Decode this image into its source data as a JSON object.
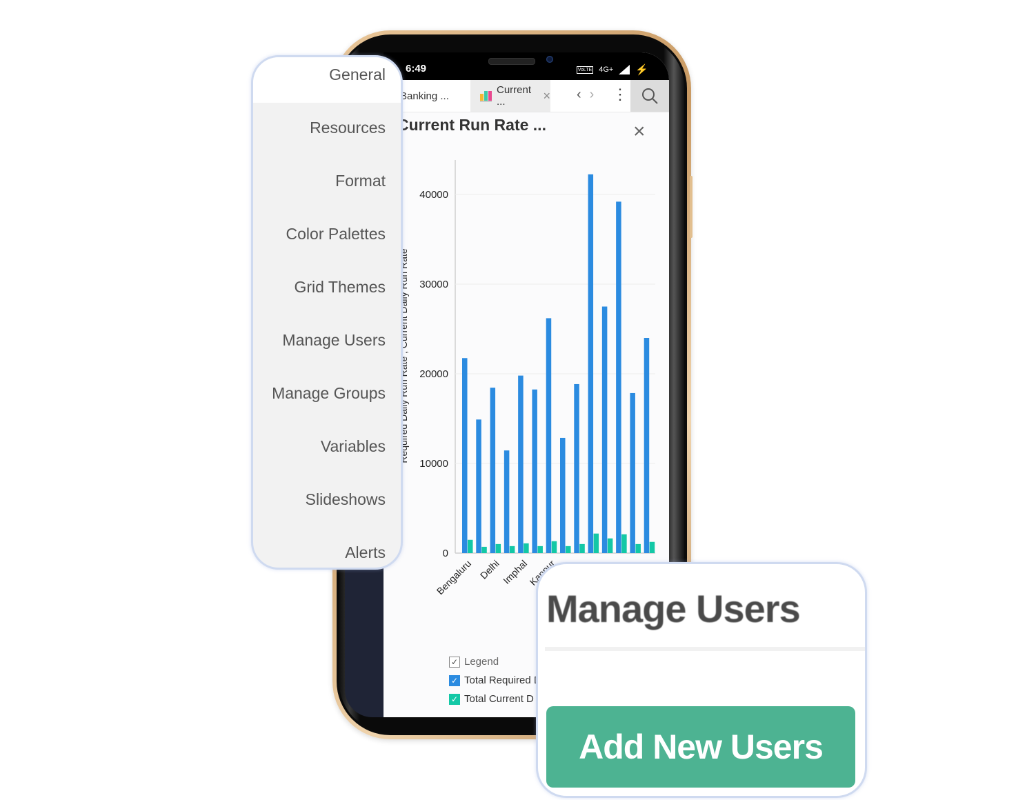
{
  "status_bar": {
    "time": "6:49",
    "network": "4G+",
    "volte": "Vo LTE"
  },
  "tabs": [
    {
      "label": "Banking ...",
      "active": false
    },
    {
      "label": "Current ...",
      "active": true,
      "icon": "bar-chart-icon"
    }
  ],
  "tab_icon_colors": [
    "#f5b731",
    "#3ec9a7",
    "#e8498f"
  ],
  "toolbar": {
    "back_icon": "‹",
    "forward_icon": "›",
    "more_icon": "⋮",
    "search_icon": "search-icon",
    "close_tab_icon": "×"
  },
  "report": {
    "title": "Current Run Rate ...",
    "close_icon": "×"
  },
  "chart_data": {
    "type": "bar",
    "title": "Current Run Rate ...",
    "xlabel": "",
    "ylabel": "Required Daily Run Rate , Current Daily Run Rate",
    "ylim": [
      0,
      44000
    ],
    "yticks": [
      0,
      10000,
      20000,
      30000,
      40000
    ],
    "ytick_labels": [
      "0",
      "10000",
      "20000",
      "30000",
      "40000"
    ],
    "grid": true,
    "categories": [
      "Bengaluru",
      "",
      "Delhi",
      "",
      "Imphal",
      "",
      "Kanpur",
      "",
      "",
      "",
      "",
      "",
      "",
      ""
    ],
    "visible_category_labels": [
      "Bengaluru",
      "Delhi",
      "Imphal",
      "Kanpur"
    ],
    "series": [
      {
        "name": "Total Required Daily Run Rate",
        "color": "#2b8be0",
        "values": [
          21750,
          14900,
          18450,
          11450,
          19800,
          18250,
          26200,
          12850,
          18850,
          42250,
          27500,
          39200,
          17850,
          24000
        ]
      },
      {
        "name": "Total Current Daily Run Rate",
        "color": "#13c8a6",
        "values": [
          1480,
          700,
          1010,
          780,
          1090,
          780,
          1330,
          780,
          1010,
          2180,
          1640,
          2100,
          1010,
          1250
        ]
      }
    ],
    "legend": {
      "title": "Legend",
      "placement": "bottom-left",
      "items": [
        {
          "label": "Total Required D",
          "color": "#2b8be0",
          "checked": true
        },
        {
          "label": "Total Current D",
          "color": "#13c8a6",
          "checked": true
        }
      ]
    }
  },
  "settings_menu": {
    "items": [
      {
        "label": "General",
        "selected": true
      },
      {
        "label": "Resources"
      },
      {
        "label": "Format"
      },
      {
        "label": "Color Palettes"
      },
      {
        "label": "Grid Themes"
      },
      {
        "label": "Manage Users"
      },
      {
        "label": "Manage Groups"
      },
      {
        "label": "Variables"
      },
      {
        "label": "Slideshows"
      },
      {
        "label": "Alerts"
      }
    ]
  },
  "manage_users_card": {
    "title": "Manage Users",
    "add_button_label": "Add New Users",
    "button_color": "#4db392"
  }
}
